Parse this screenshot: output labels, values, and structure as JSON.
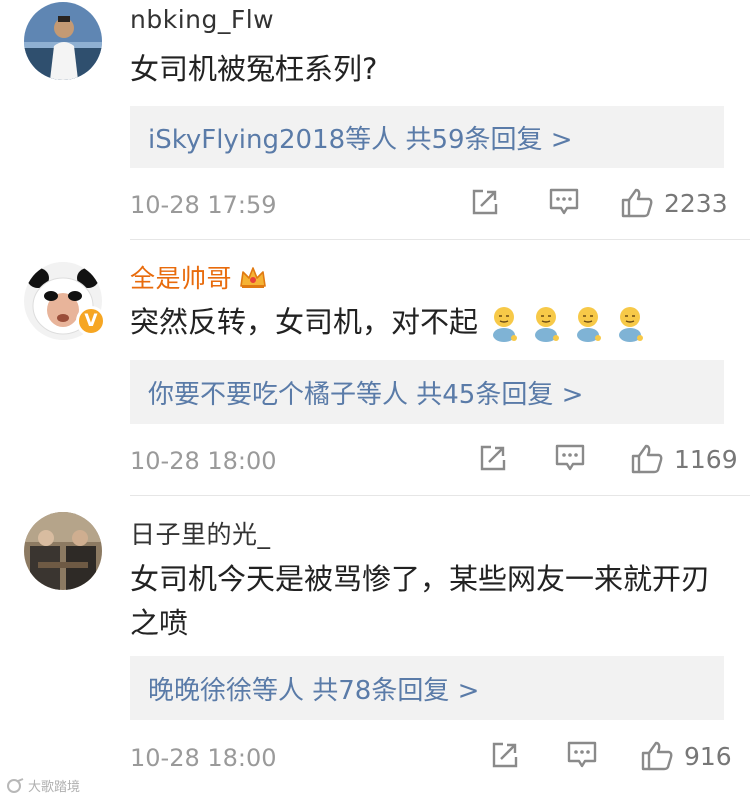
{
  "comments": [
    {
      "username": "nbking_Flw",
      "text": "女司机被冤枉系列?",
      "reply_summary": "iSkyFlying2018等人  共59条回复 >",
      "timestamp": "10-28 17:59",
      "likes": "2233"
    },
    {
      "username": "全是帅哥",
      "text": "突然反转，女司机，对不起",
      "reply_summary": "你要不要吃个橘子等人  共45条回复 >",
      "timestamp": "10-28 18:00",
      "likes": "1169"
    },
    {
      "username": "日子里的光_",
      "text": "女司机今天是被骂惨了，某些网友一来就开刃之喷",
      "reply_summary": "晚晚徐徐等人  共78条回复 >",
      "timestamp": "10-28 18:00",
      "likes": "916"
    }
  ],
  "verified_badge": "V",
  "watermark": "大歌踏境",
  "colors": {
    "username": "#333333",
    "vip_username": "#e86b0c",
    "reply_link": "#5a7ba8",
    "reply_bg": "#f2f2f2",
    "meta": "#9a9a9a"
  }
}
